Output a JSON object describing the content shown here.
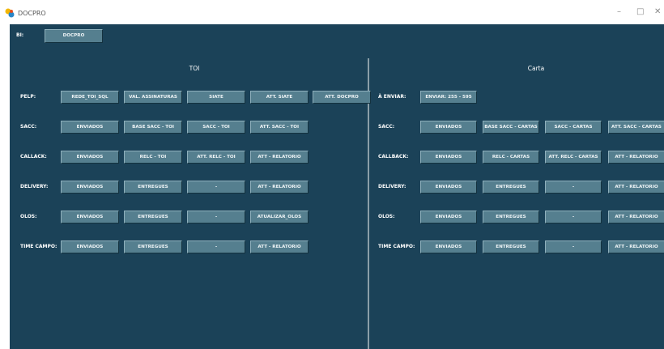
{
  "window": {
    "title": "DOCPRO",
    "minimize": "–",
    "maximize": "□",
    "close": "✕"
  },
  "toolbar": {
    "bi_label": "BI:",
    "bi_button": "DOCPRO"
  },
  "toi": {
    "title": "TOI",
    "rows": [
      {
        "label": "PELP:",
        "buttons": [
          "REDE_TOI_SQL",
          "VAL. ASSINATURAS",
          "SIATE",
          "ATT. SIATE",
          "ATT. DOCPRO"
        ]
      },
      {
        "label": "SACC:",
        "buttons": [
          "ENVIADOS",
          "BASE SACC - TOI",
          "SACC - TOI",
          "ATT. SACC - TOI"
        ]
      },
      {
        "label": "CALLACK:",
        "buttons": [
          "ENVIADOS",
          "RELC - TOI",
          "ATT. RELC - TOI",
          "ATT - RELATORIO"
        ]
      },
      {
        "label": "DELIVERY:",
        "buttons": [
          "ENVIADOS",
          "ENTREGUES",
          "-",
          "ATT - RELATORIO"
        ]
      },
      {
        "label": "OLOS:",
        "buttons": [
          "ENVIADOS",
          "ENTREGUES",
          "-",
          "ATUALIZAR_OLOS"
        ]
      },
      {
        "label": "TIME CAMPO:",
        "buttons": [
          "ENVIADOS",
          "ENTREGUES",
          "-",
          "ATT - RELATORIO"
        ]
      }
    ]
  },
  "carta": {
    "title": "Carta",
    "rows": [
      {
        "label": "À ENVIAR:",
        "buttons": [
          "ENVIAR: 255 - 595"
        ]
      },
      {
        "label": "SACC:",
        "buttons": [
          "ENVIADOS",
          "BASE SACC - CARTAS",
          "SACC - CARTAS",
          "ATT. SACC - CARTAS"
        ]
      },
      {
        "label": "CALLBACK:",
        "buttons": [
          "ENVIADOS",
          "RELC - CARTAS",
          "ATT. RELC - CARTAS",
          "ATT - RELATORIO"
        ]
      },
      {
        "label": "DELIVERY:",
        "buttons": [
          "ENVIADOS",
          "ENTREGUES",
          "-",
          "ATT - RELATORIO"
        ]
      },
      {
        "label": "OLOS:",
        "buttons": [
          "ENVIADOS",
          "ENTREGUES",
          "-",
          "ATT - RELATORIO"
        ]
      },
      {
        "label": "TIME CAMPO:",
        "buttons": [
          "ENVIADOS",
          "ENTREGUES",
          "-",
          "ATT - RELATORIO"
        ]
      }
    ]
  },
  "colors": {
    "background": "#1b4258",
    "button": "#557f8f",
    "text": "#ffffff"
  }
}
